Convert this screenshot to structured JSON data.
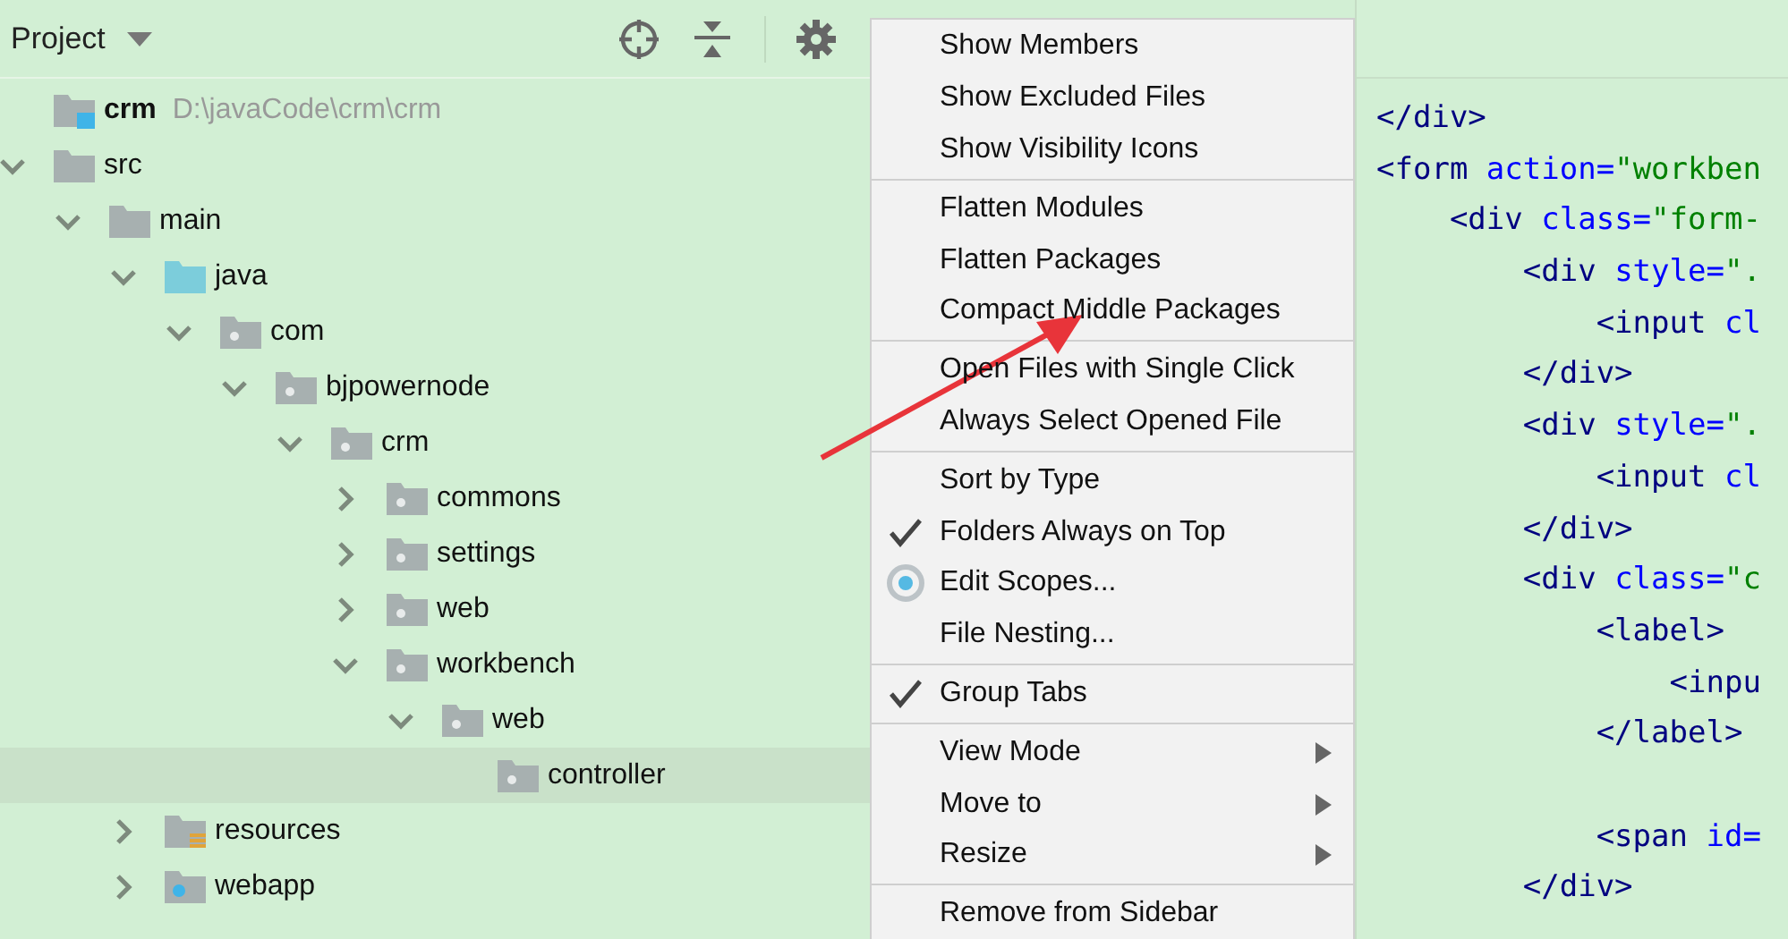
{
  "project_panel": {
    "title": "Project",
    "tree": [
      {
        "label": "crm",
        "kind": "module",
        "hint": "D:\\javaCode\\crm\\crm",
        "selected": false,
        "children": [
          {
            "label": "src",
            "kind": "plain",
            "expanded": true,
            "selected": false,
            "children": [
              {
                "label": "main",
                "kind": "plain",
                "expanded": true,
                "selected": false,
                "children": [
                  {
                    "label": "java",
                    "kind": "source",
                    "expanded": true,
                    "selected": false,
                    "children": [
                      {
                        "label": "com",
                        "kind": "package",
                        "expanded": true,
                        "selected": false,
                        "children": [
                          {
                            "label": "bjpowernode",
                            "kind": "package",
                            "expanded": true,
                            "selected": false,
                            "children": [
                              {
                                "label": "crm",
                                "kind": "package",
                                "expanded": true,
                                "selected": false,
                                "children": [
                                  {
                                    "label": "commons",
                                    "kind": "package",
                                    "expanded": false,
                                    "selected": false
                                  },
                                  {
                                    "label": "settings",
                                    "kind": "package",
                                    "expanded": false,
                                    "selected": false
                                  },
                                  {
                                    "label": "web",
                                    "kind": "package",
                                    "expanded": false,
                                    "selected": false
                                  },
                                  {
                                    "label": "workbench",
                                    "kind": "package",
                                    "expanded": true,
                                    "selected": false,
                                    "children": [
                                      {
                                        "label": "web",
                                        "kind": "package",
                                        "expanded": true,
                                        "selected": false,
                                        "children": [
                                          {
                                            "label": "controller",
                                            "kind": "package",
                                            "selected": true
                                          }
                                        ]
                                      }
                                    ]
                                  }
                                ]
                              }
                            ]
                          }
                        ]
                      }
                    ]
                  },
                  {
                    "label": "resources",
                    "kind": "resources",
                    "expanded": false,
                    "selected": false
                  },
                  {
                    "label": "webapp",
                    "kind": "webapp",
                    "expanded": false,
                    "selected": false
                  }
                ]
              }
            ]
          }
        ]
      }
    ]
  },
  "context_menu": {
    "groups": [
      {
        "items": [
          {
            "label": "Show Members",
            "kind": "plain"
          },
          {
            "label": "Show Excluded Files",
            "kind": "plain"
          },
          {
            "label": "Show Visibility Icons",
            "kind": "plain"
          }
        ]
      },
      {
        "items": [
          {
            "label": "Flatten Modules",
            "kind": "plain"
          },
          {
            "label": "Flatten Packages",
            "kind": "plain"
          },
          {
            "label": "Compact Middle Packages",
            "kind": "plain"
          }
        ]
      },
      {
        "items": [
          {
            "label": "Open Files with Single Click",
            "kind": "plain"
          },
          {
            "label": "Always Select Opened File",
            "kind": "plain"
          }
        ]
      },
      {
        "items": [
          {
            "label": "Sort by Type",
            "kind": "check",
            "checked": false
          },
          {
            "label": "Folders Always on Top",
            "kind": "check",
            "checked": true
          },
          {
            "label": "Edit Scopes...",
            "kind": "radio"
          },
          {
            "label": "File Nesting...",
            "kind": "plain"
          }
        ]
      },
      {
        "items": [
          {
            "label": "Group Tabs",
            "kind": "check",
            "checked": true
          }
        ]
      },
      {
        "items": [
          {
            "label": "View Mode",
            "kind": "submenu"
          },
          {
            "label": "Move to",
            "kind": "submenu"
          },
          {
            "label": "Resize",
            "kind": "submenu"
          }
        ]
      },
      {
        "items": [
          {
            "label": "Remove from Sidebar",
            "kind": "plain"
          }
        ]
      }
    ]
  },
  "editor": {
    "lines": [
      {
        "kind": "code",
        "tokens": [
          {
            "t": "</div>",
            "kind": "tag"
          }
        ]
      },
      {
        "kind": "code",
        "tokens": [
          {
            "t": "<form",
            "kind": "tag"
          },
          {
            "t": " action=",
            "kind": "attr"
          },
          {
            "t": "\"workben",
            "kind": "str"
          }
        ]
      },
      {
        "kind": "code",
        "tokens": [
          {
            "t": "    <div",
            "kind": "tag"
          },
          {
            "t": " class=",
            "kind": "attr"
          },
          {
            "t": "\"form-",
            "kind": "str"
          }
        ]
      },
      {
        "kind": "code",
        "tokens": [
          {
            "t": "        <div",
            "kind": "tag"
          },
          {
            "t": " style=",
            "kind": "attr"
          },
          {
            "t": "\".",
            "kind": "str"
          }
        ]
      },
      {
        "kind": "code",
        "tokens": [
          {
            "t": "            <input",
            "kind": "tag"
          },
          {
            "t": " cl",
            "kind": "attr"
          }
        ]
      },
      {
        "kind": "code",
        "tokens": [
          {
            "t": "        </div>",
            "kind": "tag"
          }
        ]
      },
      {
        "kind": "code",
        "tokens": [
          {
            "t": "        <div",
            "kind": "tag"
          },
          {
            "t": " style=",
            "kind": "attr"
          },
          {
            "t": "\".",
            "kind": "str"
          }
        ]
      },
      {
        "kind": "code",
        "tokens": [
          {
            "t": "            <input",
            "kind": "tag"
          },
          {
            "t": " cl",
            "kind": "attr"
          }
        ]
      },
      {
        "kind": "code",
        "tokens": [
          {
            "t": "        </div>",
            "kind": "tag"
          }
        ]
      },
      {
        "kind": "code",
        "tokens": [
          {
            "t": "        <div",
            "kind": "tag"
          },
          {
            "t": " class=",
            "kind": "attr"
          },
          {
            "t": "\"c",
            "kind": "str"
          }
        ]
      },
      {
        "kind": "code",
        "tokens": [
          {
            "t": "            <label>",
            "kind": "tag"
          }
        ]
      },
      {
        "kind": "code",
        "tokens": [
          {
            "t": "                <inpu",
            "kind": "tag"
          }
        ]
      },
      {
        "kind": "code",
        "tokens": [
          {
            "t": "            </label>",
            "kind": "tag"
          }
        ]
      },
      {
        "kind": "blank"
      },
      {
        "kind": "code",
        "tokens": [
          {
            "t": "            <span",
            "kind": "tag"
          },
          {
            "t": " id=",
            "kind": "attr"
          }
        ]
      },
      {
        "kind": "code",
        "tokens": [
          {
            "t": "        </div>",
            "kind": "tag"
          }
        ]
      }
    ]
  }
}
